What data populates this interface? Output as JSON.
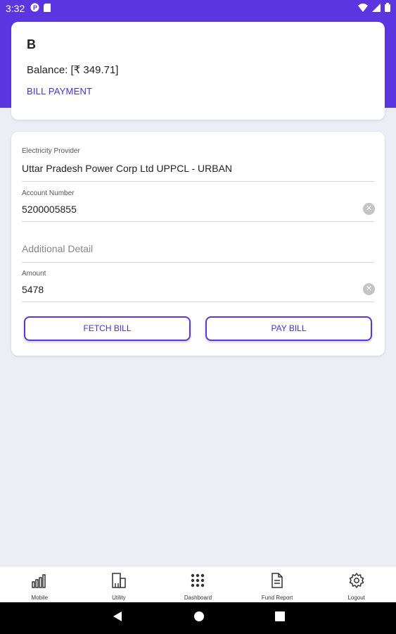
{
  "status_bar": {
    "time": "3:32",
    "icons_left": [
      "p-icon",
      "sim-icon"
    ],
    "icons_right": [
      "wifi-icon",
      "signal-icon",
      "battery-icon"
    ]
  },
  "colors": {
    "accent": "#5b36e0",
    "background": "#eceef6"
  },
  "account_card": {
    "user_name": "B",
    "balance": "Balance: [₹ 349.71]",
    "section": "BILL PAYMENT"
  },
  "form": {
    "provider": {
      "label": "Electricity Provider",
      "value": "Uttar Pradesh Power Corp Ltd UPPCL - URBAN"
    },
    "account": {
      "label": "Account Number",
      "value": "5200005855"
    },
    "additional": {
      "placeholder": "Additional Detail"
    },
    "amount": {
      "label": "Amount",
      "value": "5478"
    },
    "fetch_label": "FETCH BILL",
    "pay_label": "PAY BILL"
  },
  "bottom_nav": [
    {
      "label": "Mobile",
      "icon": "signal-bars-icon"
    },
    {
      "label": "Utility",
      "icon": "building-icon"
    },
    {
      "label": "Dashboard",
      "icon": "grid-icon"
    },
    {
      "label": "Fund Report",
      "icon": "document-icon"
    },
    {
      "label": "Logout",
      "icon": "gear-icon"
    }
  ]
}
